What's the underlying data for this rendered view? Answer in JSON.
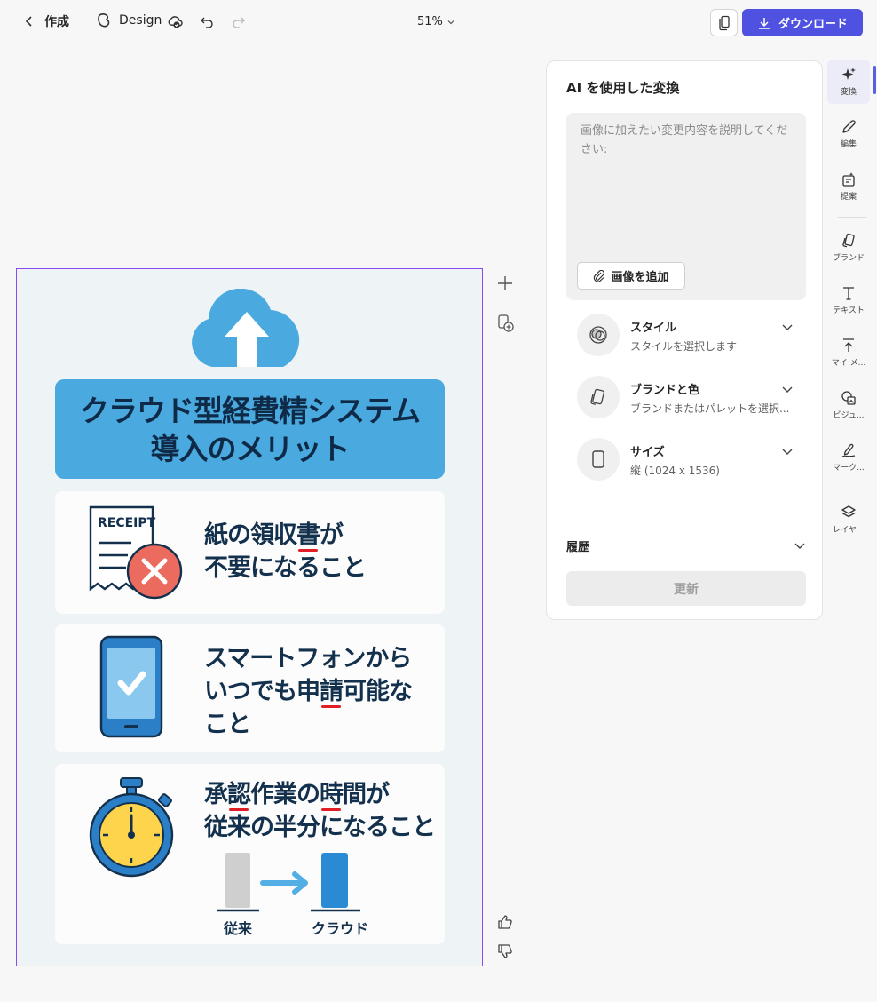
{
  "header": {
    "back_label": "作成",
    "app_name": "Design",
    "zoom": "51%",
    "download_label": "ダウンロード"
  },
  "canvas": {
    "banner_line1": "クラウド型経費精システム",
    "banner_line2": "導入のメリット",
    "card1": {
      "icon_text": "RECEIPT",
      "line1_a": "紙の領収",
      "line1_b": "書",
      "line1_c": "が",
      "line2": "不要になること"
    },
    "card2": {
      "line1": "スマートフォンから",
      "line2_a": "いつでも申",
      "line2_b": "請",
      "line2_c": "可能な",
      "line3": "こと"
    },
    "card3": {
      "line1_a": "承",
      "line1_b": "認",
      "line1_c": "作業の",
      "line1_d": "時",
      "line1_e": "間が",
      "line2": "従来の半分になること",
      "bar_label_old": "従来",
      "bar_label_new": "クラウド"
    }
  },
  "panel": {
    "title": "AI を使用した変換",
    "prompt_placeholder": "画像に加えたい変更内容を説明してください:",
    "add_image_label": "画像を追加",
    "options": [
      {
        "title": "スタイル",
        "subtitle": "スタイルを選択します",
        "icon": "style-icon"
      },
      {
        "title": "ブランドと色",
        "subtitle": "ブランドまたはパレットを選択...",
        "icon": "brand-icon"
      },
      {
        "title": "サイズ",
        "subtitle": "縦 (1024 x 1536)",
        "icon": "size-icon"
      }
    ],
    "history_label": "履歴",
    "update_label": "更新"
  },
  "rail": {
    "items": [
      {
        "label": "変換",
        "icon": "sparkle-icon"
      },
      {
        "label": "編集",
        "icon": "pencil-icon"
      },
      {
        "label": "提案",
        "icon": "suggest-icon"
      },
      {
        "label": "ブランド",
        "icon": "brand-icon"
      },
      {
        "label": "テキスト",
        "icon": "text-icon"
      },
      {
        "label": "マイ メ...",
        "icon": "upload-icon"
      },
      {
        "label": "ビジュ...",
        "icon": "visual-icon"
      },
      {
        "label": "マーク...",
        "icon": "markup-icon"
      },
      {
        "label": "レイヤー",
        "icon": "layers-icon"
      }
    ]
  },
  "colors": {
    "accent": "#4f52e0",
    "selection": "#8a4cf0",
    "banner": "#4aa9df",
    "underline": "#e11e26"
  }
}
